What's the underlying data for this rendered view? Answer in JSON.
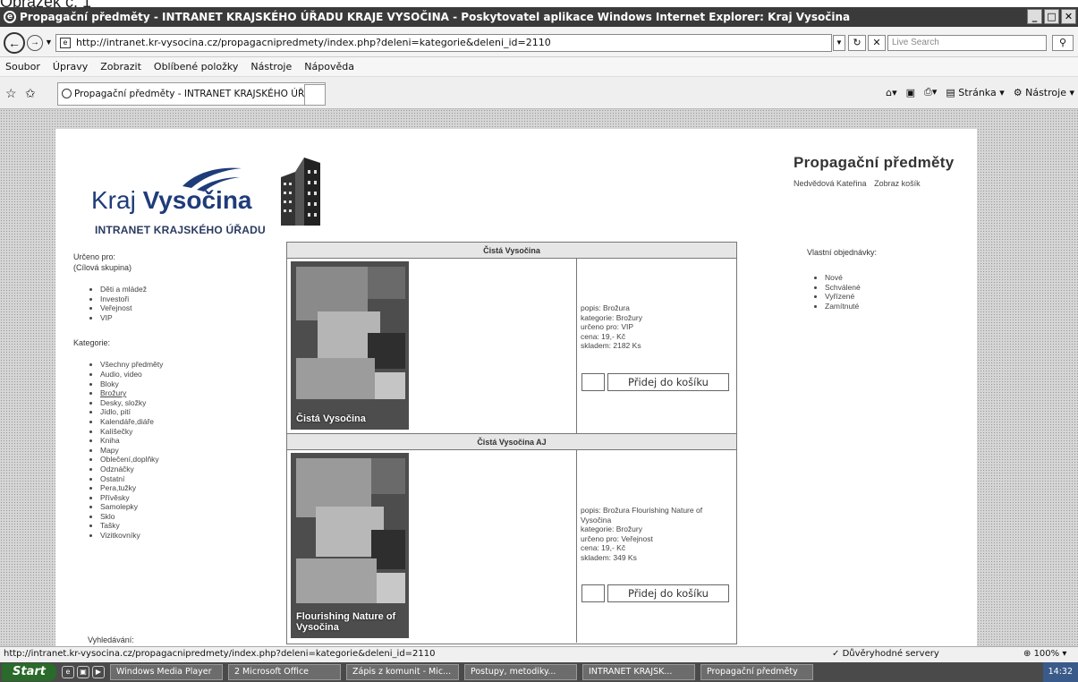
{
  "doc_caption": "Obrázek č. 1",
  "window": {
    "title": "Propagační předměty - INTRANET KRAJSKÉHO ÚŘADU KRAJE VYSOČINA - Poskytovatel aplikace Windows Internet Explorer: Kraj Vysočina"
  },
  "address": {
    "url": "http://intranet.kr-vysocina.cz/propagacnipredmety/index.php?deleni=kategorie&deleni_id=2110",
    "search_placeholder": "Live Search"
  },
  "menu": [
    "Soubor",
    "Úpravy",
    "Zobrazit",
    "Oblíbené položky",
    "Nástroje",
    "Nápověda"
  ],
  "tab": {
    "title": "Propagační předměty - INTRANET KRAJSKÉHO ÚŘAD..."
  },
  "commands": {
    "page": "Stránka",
    "tools": "Nástroje"
  },
  "site": {
    "logo_kraj": "Kraj",
    "logo_vysocina": "Vysočina",
    "logo_sub": "INTRANET KRAJSKÉHO ÚŘADU",
    "title": "Propagační předměty",
    "user": "Nedvědová Kateřina",
    "cart_link": "Zobraz košík"
  },
  "left": {
    "audience_header": "Určeno pro:",
    "audience_sub": "(Cílová skupina)",
    "audience": [
      "Děti a mládež",
      "Investoři",
      "Veřejnost",
      "VIP"
    ],
    "categories_header": "Kategorie:",
    "categories": [
      "Všechny předměty",
      "Audio, video",
      "Bloky",
      "Brožury",
      "Desky, složky",
      "Jídlo, pití",
      "Kalendáře,diáře",
      "Kalíšečky",
      "Kniha",
      "Mapy",
      "Oblečení,doplňky",
      "Odznáčky",
      "Ostatní",
      "Pera,tužky",
      "Přívěsky",
      "Samolepky",
      "Sklo",
      "Tašky",
      "Vizitkovníky"
    ],
    "selected_category": "Brožury",
    "search_header": "Vyhledávání:"
  },
  "products": [
    {
      "name": "Čistá Vysočina",
      "cover_caption": "Čistá Vysočina",
      "popis": "popis: Brožura",
      "kategorie": "kategorie: Brožury",
      "urceno": "určeno pro: VIP",
      "cena": "cena: 19,- Kč",
      "skladem": "skladem: 2182 Ks",
      "add_label": "Přidej do košíku"
    },
    {
      "name": "Čistá Vysočina AJ",
      "cover_caption": "Flourishing Nature of Vysočina",
      "popis": "popis: Brožura Flourishing Nature of Vysočina",
      "kategorie": "kategorie: Brožury",
      "urceno": "určeno pro: Veřejnost",
      "cena": "cena: 19,- Kč",
      "skladem": "skladem: 349 Ks",
      "add_label": "Přidej do košíku"
    }
  ],
  "right": {
    "header": "Vlastní objednávky:",
    "items": [
      "Nové",
      "Schválené",
      "Vyřízené",
      "Zamítnuté"
    ]
  },
  "status": {
    "url": "http://intranet.kr-vysocina.cz/propagacnipredmety/index.php?deleni=kategorie&deleni_id=2110",
    "zone": "Důvěryhodné servery",
    "zoom": "100%"
  },
  "taskbar": {
    "start": "Start",
    "items": [
      "Windows Media Player",
      "2 Microsoft Office",
      "Zápis z komunit - Mic...",
      "Postupy, metodiky...",
      "INTRANET KRAJSK...",
      "Propagační předměty"
    ],
    "clock": "14:32"
  },
  "colors": {
    "logo_blue": "#1f3c7a",
    "titlebar": "#3a3a3a"
  }
}
